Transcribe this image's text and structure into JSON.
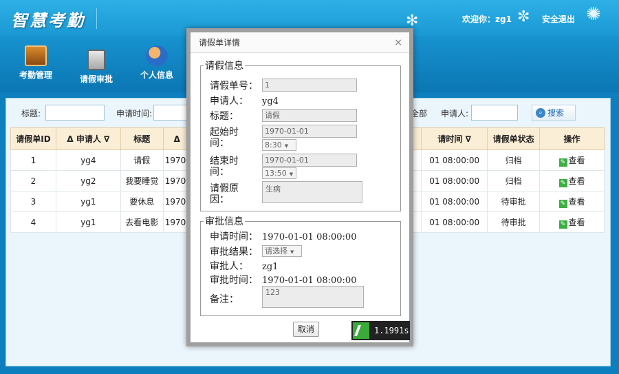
{
  "header": {
    "logo": "智慧考勤",
    "welcome": "欢迎你：zg1",
    "logout": "安全退出"
  },
  "nav": {
    "items": [
      {
        "label": "考勤管理",
        "icon": "calendar-icon"
      },
      {
        "label": "请假审批",
        "icon": "clipboard-icon"
      },
      {
        "label": "个人信息",
        "icon": "user-icon"
      }
    ]
  },
  "search": {
    "title_label": "标题:",
    "time_label": "申请时间:",
    "status_all": "全部",
    "applicant_label": "申请人:",
    "search_button": "搜索"
  },
  "table": {
    "headers": [
      "请假单ID",
      "Δ 申请人 ∇",
      "标题",
      "Δ",
      "请时间 ∇",
      "请假单状态",
      "操作"
    ],
    "rows": [
      {
        "id": "1",
        "applicant": "yg4",
        "title": "请假",
        "start": "1970-",
        "time": "01 08:00:00",
        "status": "归档",
        "action": "查看"
      },
      {
        "id": "2",
        "applicant": "yg2",
        "title": "我要睡觉",
        "start": "1970-",
        "time": "01 08:00:00",
        "status": "归档",
        "action": "查看"
      },
      {
        "id": "3",
        "applicant": "yg1",
        "title": "要休息",
        "start": "1970-",
        "time": "01 08:00:00",
        "status": "待审批",
        "action": "查看"
      },
      {
        "id": "4",
        "applicant": "yg1",
        "title": "去看电影",
        "start": "1970-",
        "time": "01 08:00:00",
        "status": "待审批",
        "action": "查看"
      }
    ]
  },
  "dialog": {
    "title": "请假单详情",
    "close": "×",
    "leave_section": "请假信息",
    "id_label": "请假单号：",
    "id_value": "1",
    "applicant_label": "申请人：",
    "applicant_value": "yg4",
    "title_label": "标题：",
    "title_value": "请假",
    "start_label": "起始时间：",
    "start_date": "1970-01-01",
    "start_time": "8:30",
    "end_label": "结束时间：",
    "end_date": "1970-01-01",
    "end_time": "13:50",
    "reason_label": "请假原因：",
    "reason_value": "生病",
    "approval_section": "审批信息",
    "apply_time_label": "申请时间：",
    "apply_time_value": "1970-01-01 08:00:00",
    "result_label": "审批结果：",
    "result_value": "请选择",
    "approver_label": "审批人：",
    "approver_value": "zg1",
    "approve_time_label": "审批时间：",
    "approve_time_value": "1970-01-01 08:00:00",
    "remark_label": "备注：",
    "remark_value": "123",
    "cancel_button": "取消"
  },
  "timer": {
    "value": "1.1991s"
  }
}
